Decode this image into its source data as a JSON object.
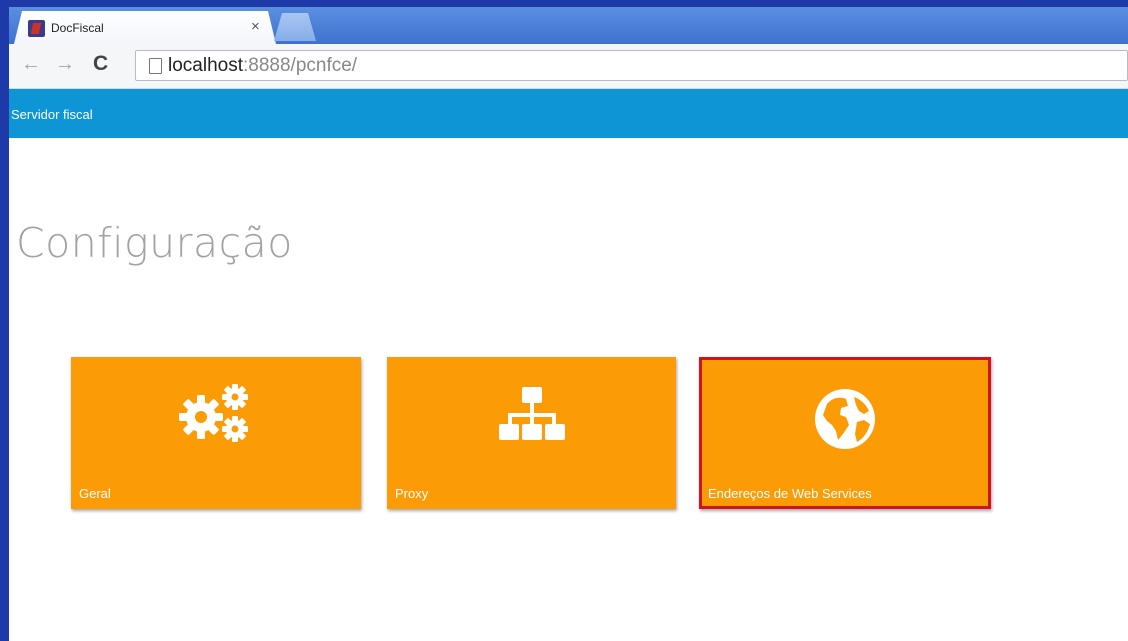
{
  "browser": {
    "tab_title": "DocFiscal",
    "tab_close": "×",
    "url_host": "localhost",
    "url_rest": ":8888/pcnfce/"
  },
  "app": {
    "header_title": "Servidor fiscal",
    "page_title": "Configuração"
  },
  "tiles": [
    {
      "label": "Geral",
      "icon": "gears-icon"
    },
    {
      "label": "Proxy",
      "icon": "sitemap-icon"
    },
    {
      "label": "Endereços de Web Services",
      "icon": "globe-icon",
      "selected": true
    }
  ],
  "colors": {
    "tile": "#fb9b05",
    "header": "#0e95d6",
    "selected_border": "#d1131b"
  }
}
